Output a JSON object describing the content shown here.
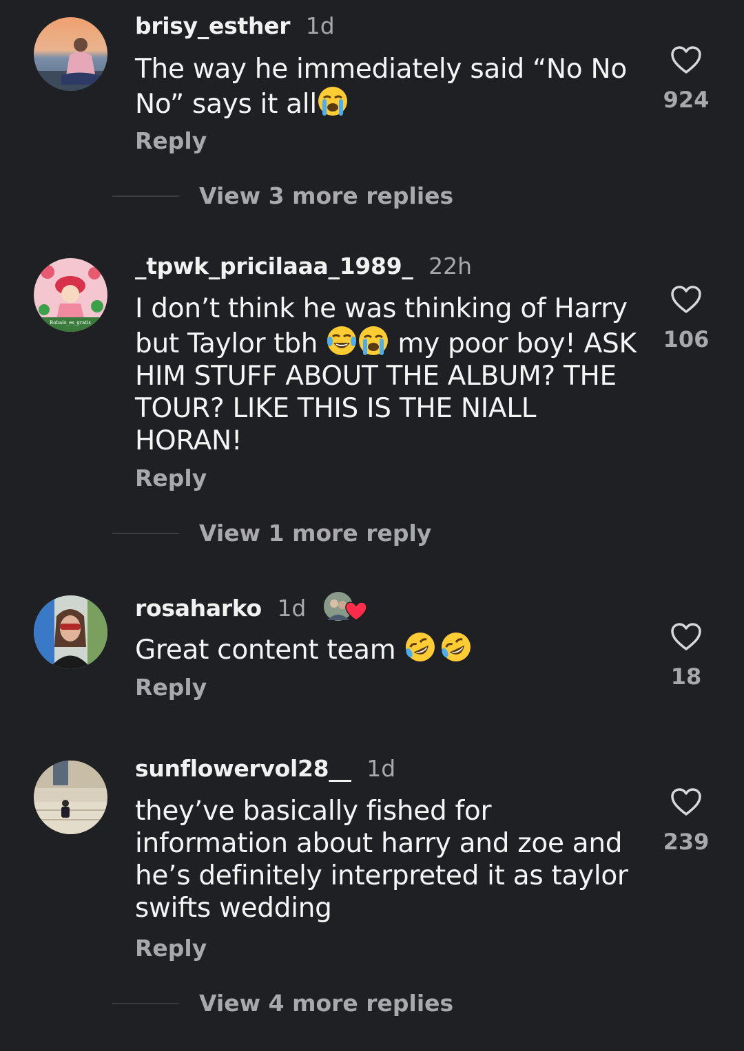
{
  "comments": [
    {
      "username": "brisy_esther",
      "time": "1d",
      "text_before": "The way he immediately said “No No No” says it all",
      "emoji": [
        "loudly-crying-face"
      ],
      "text_after": "",
      "reply_label": "Reply",
      "likes": "924",
      "view_more": "View 3 more replies"
    },
    {
      "username": "_tpwk_pricilaaa_1989_",
      "time": "22h",
      "text_before": "I don’t think he was thinking of Harry but Taylor tbh ",
      "emoji": [
        "face-with-tears-of-joy",
        "loudly-crying-face"
      ],
      "text_after": " my poor boy! ASK HIM STUFF ABOUT THE ALBUM? THE TOUR? LIKE THIS IS THE NIALL HORAN!",
      "reply_label": "Reply",
      "likes": "106",
      "view_more": "View 1 more reply"
    },
    {
      "username": "rosaharko",
      "time": "1d",
      "text_before": "Great content team ",
      "emoji": [
        "rolling-on-the-floor-laughing",
        "rolling-on-the-floor-laughing"
      ],
      "text_after": "",
      "reply_label": "Reply",
      "likes": "18"
    },
    {
      "username": "sunflowervol28__",
      "time": "1d",
      "text_before": "they’ve basically fished for information about harry and zoe and he’s definitely interpreted it as taylor swifts wedding",
      "emoji": [],
      "text_after": "",
      "reply_label": "Reply",
      "likes": "239",
      "view_more": "View 4 more replies"
    }
  ],
  "avatar_watermark": "Robalo_es_gratis",
  "colors": {
    "background": "#1f2024",
    "primary_text": "#f2f2f2",
    "secondary_text": "#a8a8ad",
    "divider": "#3a3b40",
    "heart_badge": "#ff2d4a"
  }
}
